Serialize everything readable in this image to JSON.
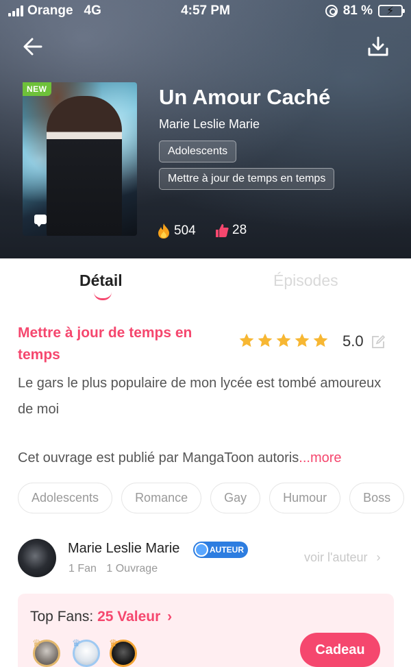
{
  "status_bar": {
    "carrier": "Orange",
    "network": "4G",
    "time": "4:57 PM",
    "battery_percent": "81 %",
    "battery_level": 0.81
  },
  "book": {
    "badge": "NEW",
    "title": "Un Amour Caché",
    "author": "Marie Leslie Marie",
    "tags": [
      "Adolescents",
      "Mettre à jour de temps en temps"
    ],
    "views": "504",
    "likes": "28"
  },
  "tabs": [
    {
      "label": "Détail",
      "active": true
    },
    {
      "label": "Épisodes",
      "active": false
    }
  ],
  "detail": {
    "update_status": "Mettre à jour de temps en temps",
    "rating": "5.0",
    "stars_filled": 5,
    "synopsis": "Le gars le plus populaire de mon lycée est tombé amoureux de moi",
    "credit": "Cet ouvrage est publié par MangaToon  autoris",
    "credit_ellipsis": "...",
    "more_label": "more",
    "genres": [
      "Adolescents",
      "Romance",
      "Gay",
      "Humour",
      "Boss"
    ]
  },
  "author_section": {
    "name": "Marie Leslie Marie",
    "badge": "AUTEUR",
    "fans": "1 Fan",
    "works": "1 Ouvrage",
    "view_author": "voir l'auteur",
    "view_author_chevron": "›"
  },
  "top_fans": {
    "label": "Top Fans: ",
    "value": "25 Valeur",
    "chevron": "›",
    "gift_button": "Cadeau"
  },
  "colors": {
    "accent": "#f5476e",
    "star": "#f7b733",
    "author_badge": "#2d7de0",
    "new_badge": "#6ec13a",
    "fans_card": "#ffeef1"
  },
  "icons": [
    "back-arrow-icon",
    "download-icon",
    "fire-icon",
    "thumbs-up-icon",
    "star-icon",
    "edit-icon",
    "chat-bubble-icon",
    "crown-icon"
  ]
}
